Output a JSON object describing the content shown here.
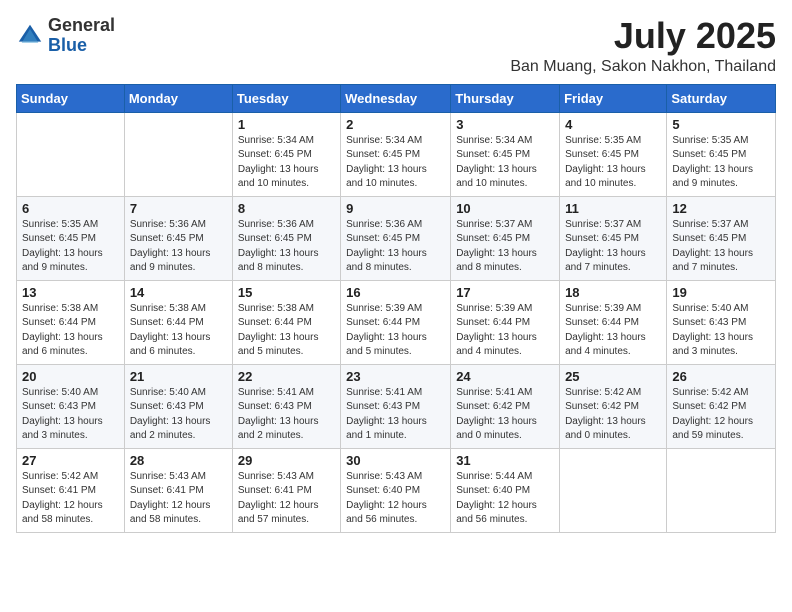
{
  "logo": {
    "general": "General",
    "blue": "Blue"
  },
  "title": {
    "month": "July 2025",
    "location": "Ban Muang, Sakon Nakhon, Thailand"
  },
  "headers": [
    "Sunday",
    "Monday",
    "Tuesday",
    "Wednesday",
    "Thursday",
    "Friday",
    "Saturday"
  ],
  "weeks": [
    [
      {
        "day": "",
        "detail": ""
      },
      {
        "day": "",
        "detail": ""
      },
      {
        "day": "1",
        "detail": "Sunrise: 5:34 AM\nSunset: 6:45 PM\nDaylight: 13 hours\nand 10 minutes."
      },
      {
        "day": "2",
        "detail": "Sunrise: 5:34 AM\nSunset: 6:45 PM\nDaylight: 13 hours\nand 10 minutes."
      },
      {
        "day": "3",
        "detail": "Sunrise: 5:34 AM\nSunset: 6:45 PM\nDaylight: 13 hours\nand 10 minutes."
      },
      {
        "day": "4",
        "detail": "Sunrise: 5:35 AM\nSunset: 6:45 PM\nDaylight: 13 hours\nand 10 minutes."
      },
      {
        "day": "5",
        "detail": "Sunrise: 5:35 AM\nSunset: 6:45 PM\nDaylight: 13 hours\nand 9 minutes."
      }
    ],
    [
      {
        "day": "6",
        "detail": "Sunrise: 5:35 AM\nSunset: 6:45 PM\nDaylight: 13 hours\nand 9 minutes."
      },
      {
        "day": "7",
        "detail": "Sunrise: 5:36 AM\nSunset: 6:45 PM\nDaylight: 13 hours\nand 9 minutes."
      },
      {
        "day": "8",
        "detail": "Sunrise: 5:36 AM\nSunset: 6:45 PM\nDaylight: 13 hours\nand 8 minutes."
      },
      {
        "day": "9",
        "detail": "Sunrise: 5:36 AM\nSunset: 6:45 PM\nDaylight: 13 hours\nand 8 minutes."
      },
      {
        "day": "10",
        "detail": "Sunrise: 5:37 AM\nSunset: 6:45 PM\nDaylight: 13 hours\nand 8 minutes."
      },
      {
        "day": "11",
        "detail": "Sunrise: 5:37 AM\nSunset: 6:45 PM\nDaylight: 13 hours\nand 7 minutes."
      },
      {
        "day": "12",
        "detail": "Sunrise: 5:37 AM\nSunset: 6:45 PM\nDaylight: 13 hours\nand 7 minutes."
      }
    ],
    [
      {
        "day": "13",
        "detail": "Sunrise: 5:38 AM\nSunset: 6:44 PM\nDaylight: 13 hours\nand 6 minutes."
      },
      {
        "day": "14",
        "detail": "Sunrise: 5:38 AM\nSunset: 6:44 PM\nDaylight: 13 hours\nand 6 minutes."
      },
      {
        "day": "15",
        "detail": "Sunrise: 5:38 AM\nSunset: 6:44 PM\nDaylight: 13 hours\nand 5 minutes."
      },
      {
        "day": "16",
        "detail": "Sunrise: 5:39 AM\nSunset: 6:44 PM\nDaylight: 13 hours\nand 5 minutes."
      },
      {
        "day": "17",
        "detail": "Sunrise: 5:39 AM\nSunset: 6:44 PM\nDaylight: 13 hours\nand 4 minutes."
      },
      {
        "day": "18",
        "detail": "Sunrise: 5:39 AM\nSunset: 6:44 PM\nDaylight: 13 hours\nand 4 minutes."
      },
      {
        "day": "19",
        "detail": "Sunrise: 5:40 AM\nSunset: 6:43 PM\nDaylight: 13 hours\nand 3 minutes."
      }
    ],
    [
      {
        "day": "20",
        "detail": "Sunrise: 5:40 AM\nSunset: 6:43 PM\nDaylight: 13 hours\nand 3 minutes."
      },
      {
        "day": "21",
        "detail": "Sunrise: 5:40 AM\nSunset: 6:43 PM\nDaylight: 13 hours\nand 2 minutes."
      },
      {
        "day": "22",
        "detail": "Sunrise: 5:41 AM\nSunset: 6:43 PM\nDaylight: 13 hours\nand 2 minutes."
      },
      {
        "day": "23",
        "detail": "Sunrise: 5:41 AM\nSunset: 6:43 PM\nDaylight: 13 hours\nand 1 minute."
      },
      {
        "day": "24",
        "detail": "Sunrise: 5:41 AM\nSunset: 6:42 PM\nDaylight: 13 hours\nand 0 minutes."
      },
      {
        "day": "25",
        "detail": "Sunrise: 5:42 AM\nSunset: 6:42 PM\nDaylight: 13 hours\nand 0 minutes."
      },
      {
        "day": "26",
        "detail": "Sunrise: 5:42 AM\nSunset: 6:42 PM\nDaylight: 12 hours\nand 59 minutes."
      }
    ],
    [
      {
        "day": "27",
        "detail": "Sunrise: 5:42 AM\nSunset: 6:41 PM\nDaylight: 12 hours\nand 58 minutes."
      },
      {
        "day": "28",
        "detail": "Sunrise: 5:43 AM\nSunset: 6:41 PM\nDaylight: 12 hours\nand 58 minutes."
      },
      {
        "day": "29",
        "detail": "Sunrise: 5:43 AM\nSunset: 6:41 PM\nDaylight: 12 hours\nand 57 minutes."
      },
      {
        "day": "30",
        "detail": "Sunrise: 5:43 AM\nSunset: 6:40 PM\nDaylight: 12 hours\nand 56 minutes."
      },
      {
        "day": "31",
        "detail": "Sunrise: 5:44 AM\nSunset: 6:40 PM\nDaylight: 12 hours\nand 56 minutes."
      },
      {
        "day": "",
        "detail": ""
      },
      {
        "day": "",
        "detail": ""
      }
    ]
  ]
}
